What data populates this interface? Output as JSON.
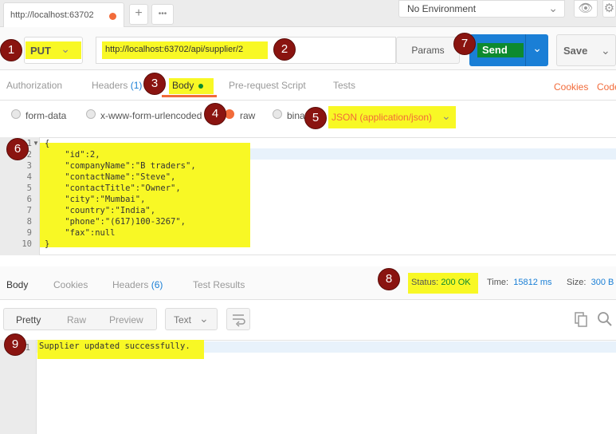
{
  "tabs": {
    "active_tab_label": "http://localhost:63702",
    "new_tab": "+",
    "more": "•••"
  },
  "environment": {
    "selected": "No Environment"
  },
  "request": {
    "method": "PUT",
    "url": "http://localhost:63702/api/supplier/2",
    "params_label": "Params",
    "send_label": "Send",
    "save_label": "Save"
  },
  "request_tabs": {
    "authorization": "Authorization",
    "headers": "Headers",
    "headers_count": "(1)",
    "body": "Body",
    "pre_request": "Pre-request Script",
    "tests": "Tests",
    "cookies": "Cookies",
    "code": "Code"
  },
  "body_types": {
    "form_data": "form-data",
    "urlencoded": "x-www-form-urlencoded",
    "raw": "raw",
    "binary": "binary",
    "content_type": "JSON (application/json)",
    "selected": "raw"
  },
  "editor": {
    "lines": [
      {
        "num": "1",
        "text": "{"
      },
      {
        "num": "2",
        "text": "    \"id\":2,"
      },
      {
        "num": "3",
        "text": "    \"companyName\":\"B traders\","
      },
      {
        "num": "4",
        "text": "    \"contactName\":\"Steve\","
      },
      {
        "num": "5",
        "text": "    \"contactTitle\":\"Owner\","
      },
      {
        "num": "6",
        "text": "    \"city\":\"Mumbai\","
      },
      {
        "num": "7",
        "text": "    \"country\":\"India\","
      },
      {
        "num": "8",
        "text": "    \"phone\":\"(617)100-3267\","
      },
      {
        "num": "9",
        "text": "    \"fax\":null"
      },
      {
        "num": "10",
        "text": "}"
      }
    ]
  },
  "response_tabs": {
    "body": "Body",
    "cookies": "Cookies",
    "headers": "Headers",
    "headers_count": "(6)",
    "test_results": "Test Results"
  },
  "response_meta": {
    "status_label": "Status:",
    "status_value": "200 OK",
    "time_label": "Time:",
    "time_value": "15812 ms",
    "size_label": "Size:",
    "size_value": "300 B"
  },
  "response_view": {
    "pretty": "Pretty",
    "raw": "Raw",
    "preview": "Preview",
    "format": "Text"
  },
  "response_body": {
    "line_num": "1",
    "text": "Supplier updated successfully."
  },
  "annotations": [
    "1",
    "2",
    "3",
    "4",
    "5",
    "6",
    "7",
    "8",
    "9"
  ],
  "colors": {
    "accent": "#f26b3a",
    "send": "#1a7fd6",
    "highlight": "#f8f825",
    "badge": "#8a1410",
    "ok": "#0d8a2f"
  }
}
